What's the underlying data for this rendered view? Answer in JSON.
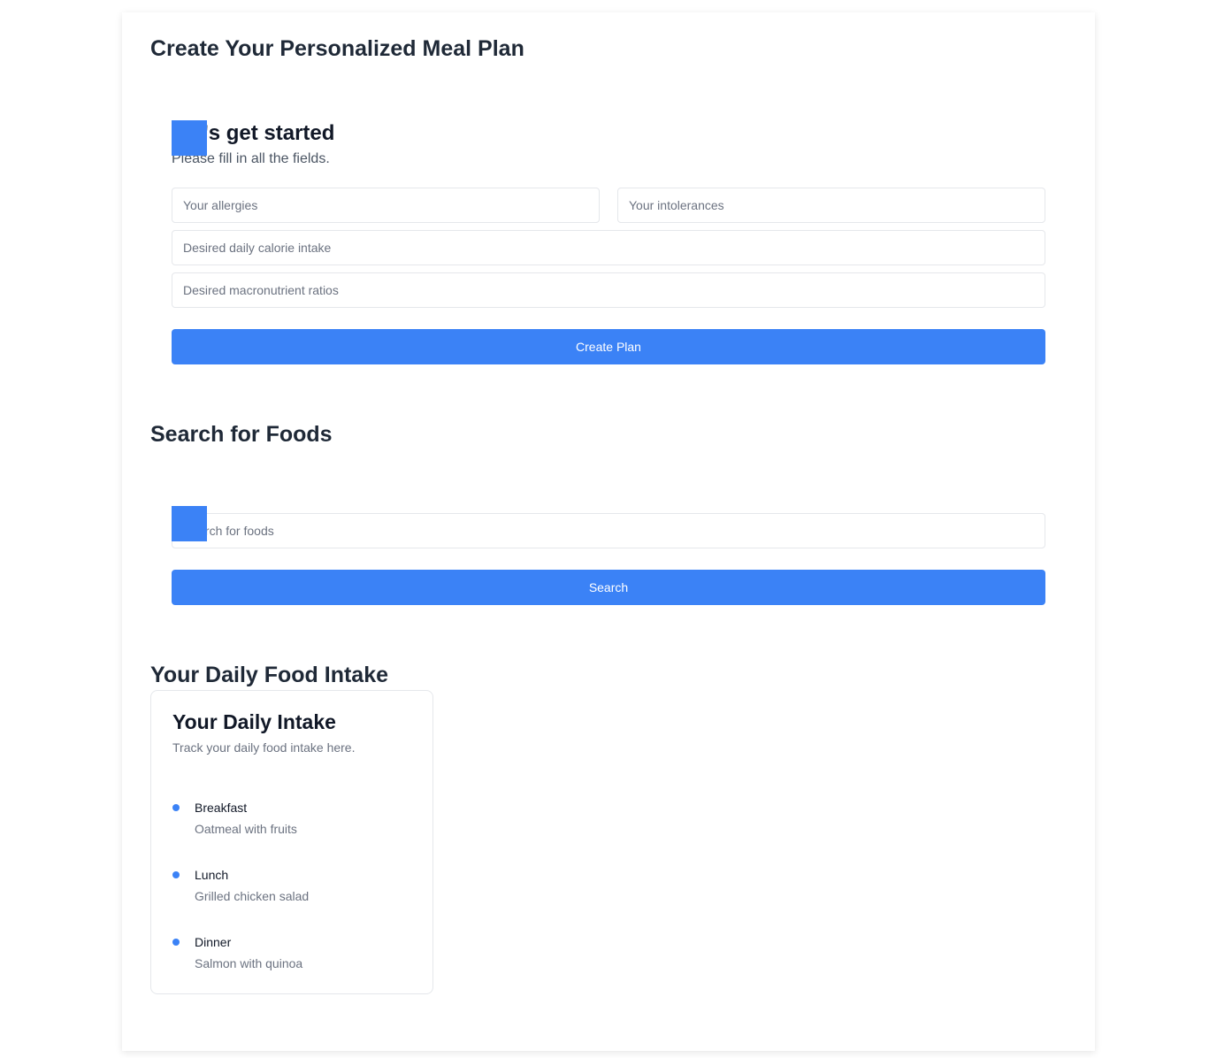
{
  "meal_plan": {
    "title": "Create Your Personalized Meal Plan",
    "form_heading": "Let's get started",
    "form_subtitle": "Please fill in all the fields.",
    "allergies_placeholder": "Your allergies",
    "intolerances_placeholder": "Your intolerances",
    "calorie_placeholder": "Desired daily calorie intake",
    "macro_placeholder": "Desired macronutrient ratios",
    "create_button": "Create Plan"
  },
  "food_search": {
    "title": "Search for Foods",
    "search_placeholder": "Search for foods",
    "search_button": "Search"
  },
  "daily_intake": {
    "title": "Your Daily Food Intake",
    "card_title": "Your Daily Intake",
    "card_description": "Track your daily food intake here.",
    "meals": [
      {
        "name": "Breakfast",
        "food": "Oatmeal with fruits"
      },
      {
        "name": "Lunch",
        "food": "Grilled chicken salad"
      },
      {
        "name": "Dinner",
        "food": "Salmon with quinoa"
      }
    ]
  },
  "colors": {
    "accent": "#3b82f6",
    "heading": "#1f2937",
    "muted": "#6b7280",
    "border": "#e5e7eb"
  }
}
